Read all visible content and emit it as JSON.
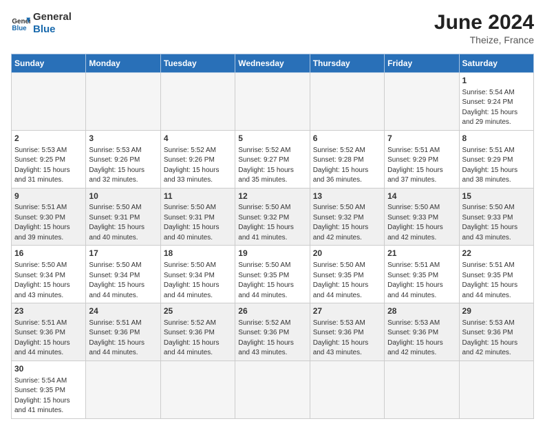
{
  "header": {
    "logo_general": "General",
    "logo_blue": "Blue",
    "month_year": "June 2024",
    "location": "Theize, France"
  },
  "days_of_week": [
    "Sunday",
    "Monday",
    "Tuesday",
    "Wednesday",
    "Thursday",
    "Friday",
    "Saturday"
  ],
  "weeks": [
    {
      "shade": false,
      "days": [
        {
          "num": "",
          "info": ""
        },
        {
          "num": "",
          "info": ""
        },
        {
          "num": "",
          "info": ""
        },
        {
          "num": "",
          "info": ""
        },
        {
          "num": "",
          "info": ""
        },
        {
          "num": "",
          "info": ""
        },
        {
          "num": "1",
          "info": "Sunrise: 5:54 AM\nSunset: 9:24 PM\nDaylight: 15 hours\nand 29 minutes."
        }
      ]
    },
    {
      "shade": false,
      "days": [
        {
          "num": "2",
          "info": "Sunrise: 5:53 AM\nSunset: 9:25 PM\nDaylight: 15 hours\nand 31 minutes."
        },
        {
          "num": "3",
          "info": "Sunrise: 5:53 AM\nSunset: 9:26 PM\nDaylight: 15 hours\nand 32 minutes."
        },
        {
          "num": "4",
          "info": "Sunrise: 5:52 AM\nSunset: 9:26 PM\nDaylight: 15 hours\nand 33 minutes."
        },
        {
          "num": "5",
          "info": "Sunrise: 5:52 AM\nSunset: 9:27 PM\nDaylight: 15 hours\nand 35 minutes."
        },
        {
          "num": "6",
          "info": "Sunrise: 5:52 AM\nSunset: 9:28 PM\nDaylight: 15 hours\nand 36 minutes."
        },
        {
          "num": "7",
          "info": "Sunrise: 5:51 AM\nSunset: 9:29 PM\nDaylight: 15 hours\nand 37 minutes."
        },
        {
          "num": "8",
          "info": "Sunrise: 5:51 AM\nSunset: 9:29 PM\nDaylight: 15 hours\nand 38 minutes."
        }
      ]
    },
    {
      "shade": true,
      "days": [
        {
          "num": "9",
          "info": "Sunrise: 5:51 AM\nSunset: 9:30 PM\nDaylight: 15 hours\nand 39 minutes."
        },
        {
          "num": "10",
          "info": "Sunrise: 5:50 AM\nSunset: 9:31 PM\nDaylight: 15 hours\nand 40 minutes."
        },
        {
          "num": "11",
          "info": "Sunrise: 5:50 AM\nSunset: 9:31 PM\nDaylight: 15 hours\nand 40 minutes."
        },
        {
          "num": "12",
          "info": "Sunrise: 5:50 AM\nSunset: 9:32 PM\nDaylight: 15 hours\nand 41 minutes."
        },
        {
          "num": "13",
          "info": "Sunrise: 5:50 AM\nSunset: 9:32 PM\nDaylight: 15 hours\nand 42 minutes."
        },
        {
          "num": "14",
          "info": "Sunrise: 5:50 AM\nSunset: 9:33 PM\nDaylight: 15 hours\nand 42 minutes."
        },
        {
          "num": "15",
          "info": "Sunrise: 5:50 AM\nSunset: 9:33 PM\nDaylight: 15 hours\nand 43 minutes."
        }
      ]
    },
    {
      "shade": false,
      "days": [
        {
          "num": "16",
          "info": "Sunrise: 5:50 AM\nSunset: 9:34 PM\nDaylight: 15 hours\nand 43 minutes."
        },
        {
          "num": "17",
          "info": "Sunrise: 5:50 AM\nSunset: 9:34 PM\nDaylight: 15 hours\nand 44 minutes."
        },
        {
          "num": "18",
          "info": "Sunrise: 5:50 AM\nSunset: 9:34 PM\nDaylight: 15 hours\nand 44 minutes."
        },
        {
          "num": "19",
          "info": "Sunrise: 5:50 AM\nSunset: 9:35 PM\nDaylight: 15 hours\nand 44 minutes."
        },
        {
          "num": "20",
          "info": "Sunrise: 5:50 AM\nSunset: 9:35 PM\nDaylight: 15 hours\nand 44 minutes."
        },
        {
          "num": "21",
          "info": "Sunrise: 5:51 AM\nSunset: 9:35 PM\nDaylight: 15 hours\nand 44 minutes."
        },
        {
          "num": "22",
          "info": "Sunrise: 5:51 AM\nSunset: 9:35 PM\nDaylight: 15 hours\nand 44 minutes."
        }
      ]
    },
    {
      "shade": true,
      "days": [
        {
          "num": "23",
          "info": "Sunrise: 5:51 AM\nSunset: 9:36 PM\nDaylight: 15 hours\nand 44 minutes."
        },
        {
          "num": "24",
          "info": "Sunrise: 5:51 AM\nSunset: 9:36 PM\nDaylight: 15 hours\nand 44 minutes."
        },
        {
          "num": "25",
          "info": "Sunrise: 5:52 AM\nSunset: 9:36 PM\nDaylight: 15 hours\nand 44 minutes."
        },
        {
          "num": "26",
          "info": "Sunrise: 5:52 AM\nSunset: 9:36 PM\nDaylight: 15 hours\nand 43 minutes."
        },
        {
          "num": "27",
          "info": "Sunrise: 5:53 AM\nSunset: 9:36 PM\nDaylight: 15 hours\nand 43 minutes."
        },
        {
          "num": "28",
          "info": "Sunrise: 5:53 AM\nSunset: 9:36 PM\nDaylight: 15 hours\nand 42 minutes."
        },
        {
          "num": "29",
          "info": "Sunrise: 5:53 AM\nSunset: 9:36 PM\nDaylight: 15 hours\nand 42 minutes."
        }
      ]
    },
    {
      "shade": false,
      "days": [
        {
          "num": "30",
          "info": "Sunrise: 5:54 AM\nSunset: 9:35 PM\nDaylight: 15 hours\nand 41 minutes."
        },
        {
          "num": "",
          "info": ""
        },
        {
          "num": "",
          "info": ""
        },
        {
          "num": "",
          "info": ""
        },
        {
          "num": "",
          "info": ""
        },
        {
          "num": "",
          "info": ""
        },
        {
          "num": "",
          "info": ""
        }
      ]
    }
  ]
}
